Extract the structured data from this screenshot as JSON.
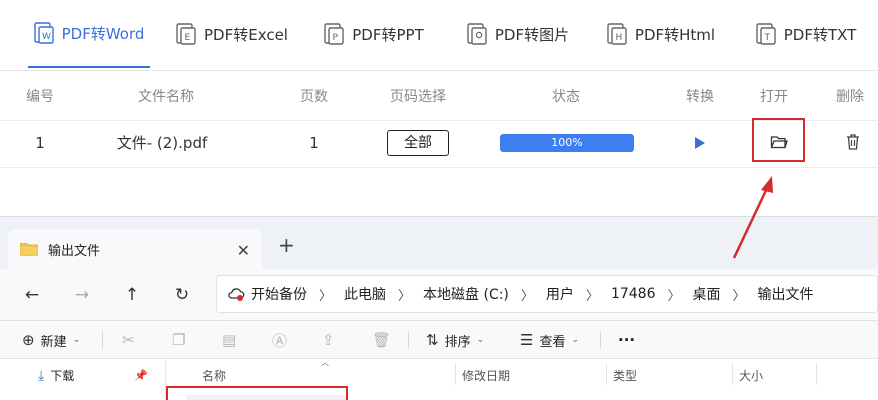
{
  "tabs": [
    {
      "label": "PDF转Word",
      "icon": "pdf-to-word-icon",
      "active": true
    },
    {
      "label": "PDF转Excel",
      "icon": "pdf-to-excel-icon",
      "active": false
    },
    {
      "label": "PDF转PPT",
      "icon": "pdf-to-ppt-icon",
      "active": false
    },
    {
      "label": "PDF转图片",
      "icon": "pdf-to-image-icon",
      "active": false
    },
    {
      "label": "PDF转Html",
      "icon": "pdf-to-html-icon",
      "active": false
    },
    {
      "label": "PDF转TXT",
      "icon": "pdf-to-txt-icon",
      "active": false
    }
  ],
  "table": {
    "headers": [
      "编号",
      "文件名称",
      "页数",
      "页码选择",
      "状态",
      "转换",
      "打开",
      "删除"
    ],
    "rows": [
      {
        "index": "1",
        "filename": "文件- (2).pdf",
        "pages": "1",
        "page_select": "全部",
        "progress_text": "100%",
        "progress": 1.0
      }
    ]
  },
  "colors": {
    "accent": "#3a6fd8",
    "progress": "#3d7ef0",
    "highlight": "#d62b2b"
  },
  "explorer": {
    "tab_title": "输出文件",
    "close": "✕",
    "new_tab": "+",
    "breadcrumb": [
      "开始备份",
      "此电脑",
      "本地磁盘 (C:)",
      "用户",
      "17486",
      "桌面",
      "输出文件"
    ],
    "toolbar": {
      "new_label": "新建",
      "sort_label": "排序",
      "view_label": "查看",
      "more": "···"
    },
    "sidebar_item": "下载",
    "columns": [
      "名称",
      "修改日期",
      "类型",
      "大小"
    ]
  }
}
